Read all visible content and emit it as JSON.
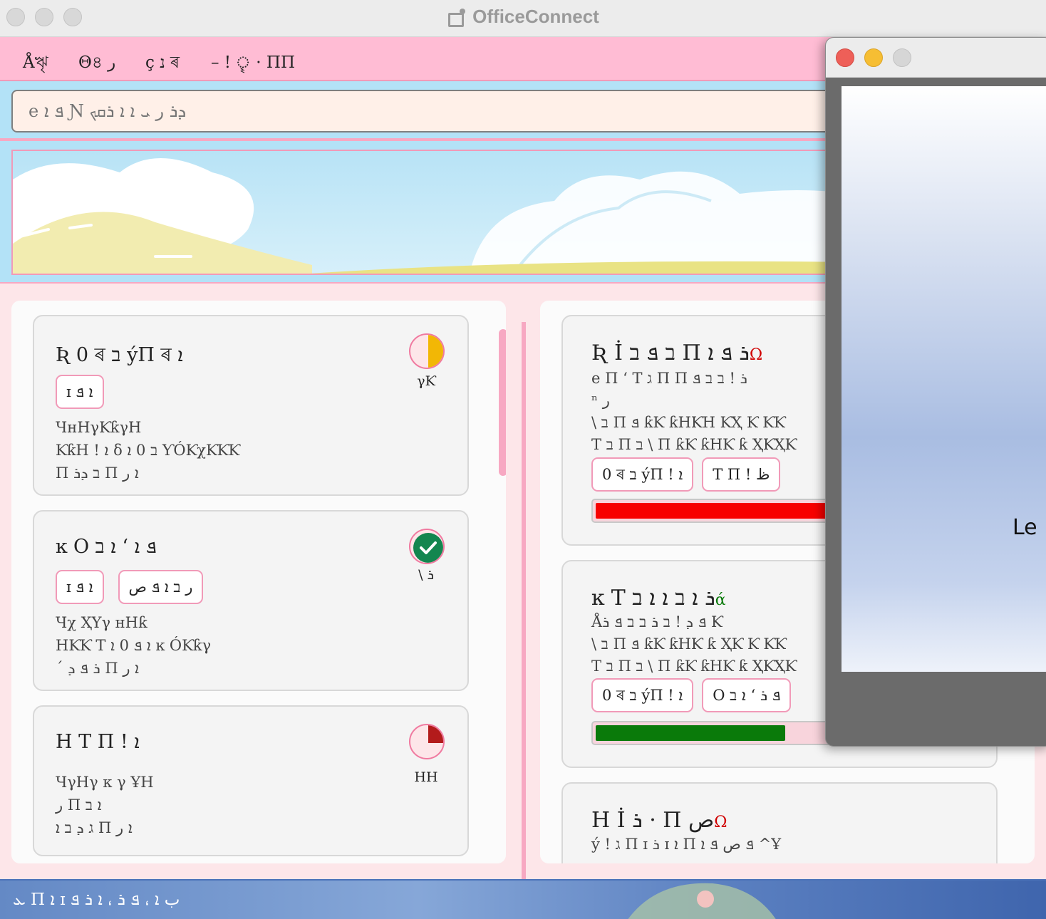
{
  "app": {
    "title": "OfficeConnect"
  },
  "menu": [
    "Åৠ",
    "Θ৪ ر",
    "ç נ ৰ",
    "– ! ৄ · ΠΠ"
  ],
  "search": {
    "placeholder": "e ܦ ܐ Ɲ ܕܪ ر ܝ ܐ ܐ ܪܩܟ"
  },
  "tasks": [
    {
      "title": "Ʀ 0 ৰ ב ýΠ ৰ ܐ",
      "chips": [
        "ɪ ܐ ܦ"
      ],
      "lines": [
        "ЧʜΗγƘƙγΗ",
        "ƘƙΗ ! ܐ δ ב 0 ܐ ƳÓƘχƘƘƘ",
        "Π ב ܕܪ Π ܐ ر"
      ],
      "status": "γƘ",
      "progress": 0.5,
      "color": "#f2b705"
    },
    {
      "title": "ĸ Ο ܦ ܐ ‘ ܐ ב",
      "chips": [
        "ɪ ܐ ܦ",
        "ر ב ܐ ܦ ص"
      ],
      "lines": [
        "Чχ ҲΥγ ʜΗƙ",
        "ΗƘƘ T ܐ ܦ 0 ܐ ĸ ÓƘƙγ",
        "´ ܪ ܦ ܕ Π ܐ ر"
      ],
      "status": "\\ ܪ",
      "progress": 1.0,
      "color": "#13864f"
    },
    {
      "title": "Η T Π ! ܐ",
      "chips": [],
      "lines": [
        "ЧγΗγ κ γ ҰΗ",
        "ر Π ܐ ב",
        "ג ܕ ב ܐ Π ܐ ر"
      ],
      "status": "ΗΗ",
      "progress": 0.25,
      "color": "#b31b1b"
    }
  ],
  "projects": [
    {
      "title": "Ʀ İ ב ܦ ב Π ܪ ܦ ܐ",
      "mark": "Ω",
      "mark_color": "#d00000",
      "lines": [
        "e Π ‘ T ג Π Π ܪ ! ב ב ܦ",
        "ⁿ ر",
        "\\ ב Π ܦ ƙƘ ƙΗƘΗ ƘҲ Ƙ ƘƘ",
        "T ב Π ב \\ Π ƙƘ ƙΗƘ ƙ ҲƘҲƘ"
      ],
      "chips": [
        "0 ৰ ב ýΠ ! ܐ",
        "T Π ! ظ"
      ],
      "progress": 0.62,
      "bar_color": "#f70000"
    },
    {
      "title": "ĸ T ܪ ܐ ב ܐ ܐ ב",
      "mark": "ά",
      "mark_color": "#0a7a0a",
      "lines": [
        "Åܦ ܕ ! ב ܪ ב ב ܦ ܪ Ƙ",
        "\\ ב Π ܦ ƙƘ ƙΗƘ ƙ ҲƘ Ƙ ƘƘ",
        "T ב Π ב \\ Π ƙƘ ƙΗƘ ƙ ҲƘҲƘ"
      ],
      "chips": [
        "0 ৰ ב ýΠ ! ܐ",
        "Ο ܦ ܪ ‘ ܐ ב"
      ],
      "progress": 0.5,
      "bar_color": "#0a7a0a"
    },
    {
      "title": "Η İ ܪ · Π ص",
      "mark": "Ω",
      "mark_color": "#d00000",
      "lines": [
        "ý ! ג Π ɪ ܪ ɪ ܐ Π ܦ ص ܦ ܐ ^Ұ"
      ],
      "chips": [],
      "progress": null,
      "bar_color": ""
    }
  ],
  "popup": {
    "text": "Le"
  },
  "dock": {
    "text": "ܥ Π ܐ ɪ ب ܐ ، ܦ ܪ ، ܐ ܪ ܦ"
  }
}
